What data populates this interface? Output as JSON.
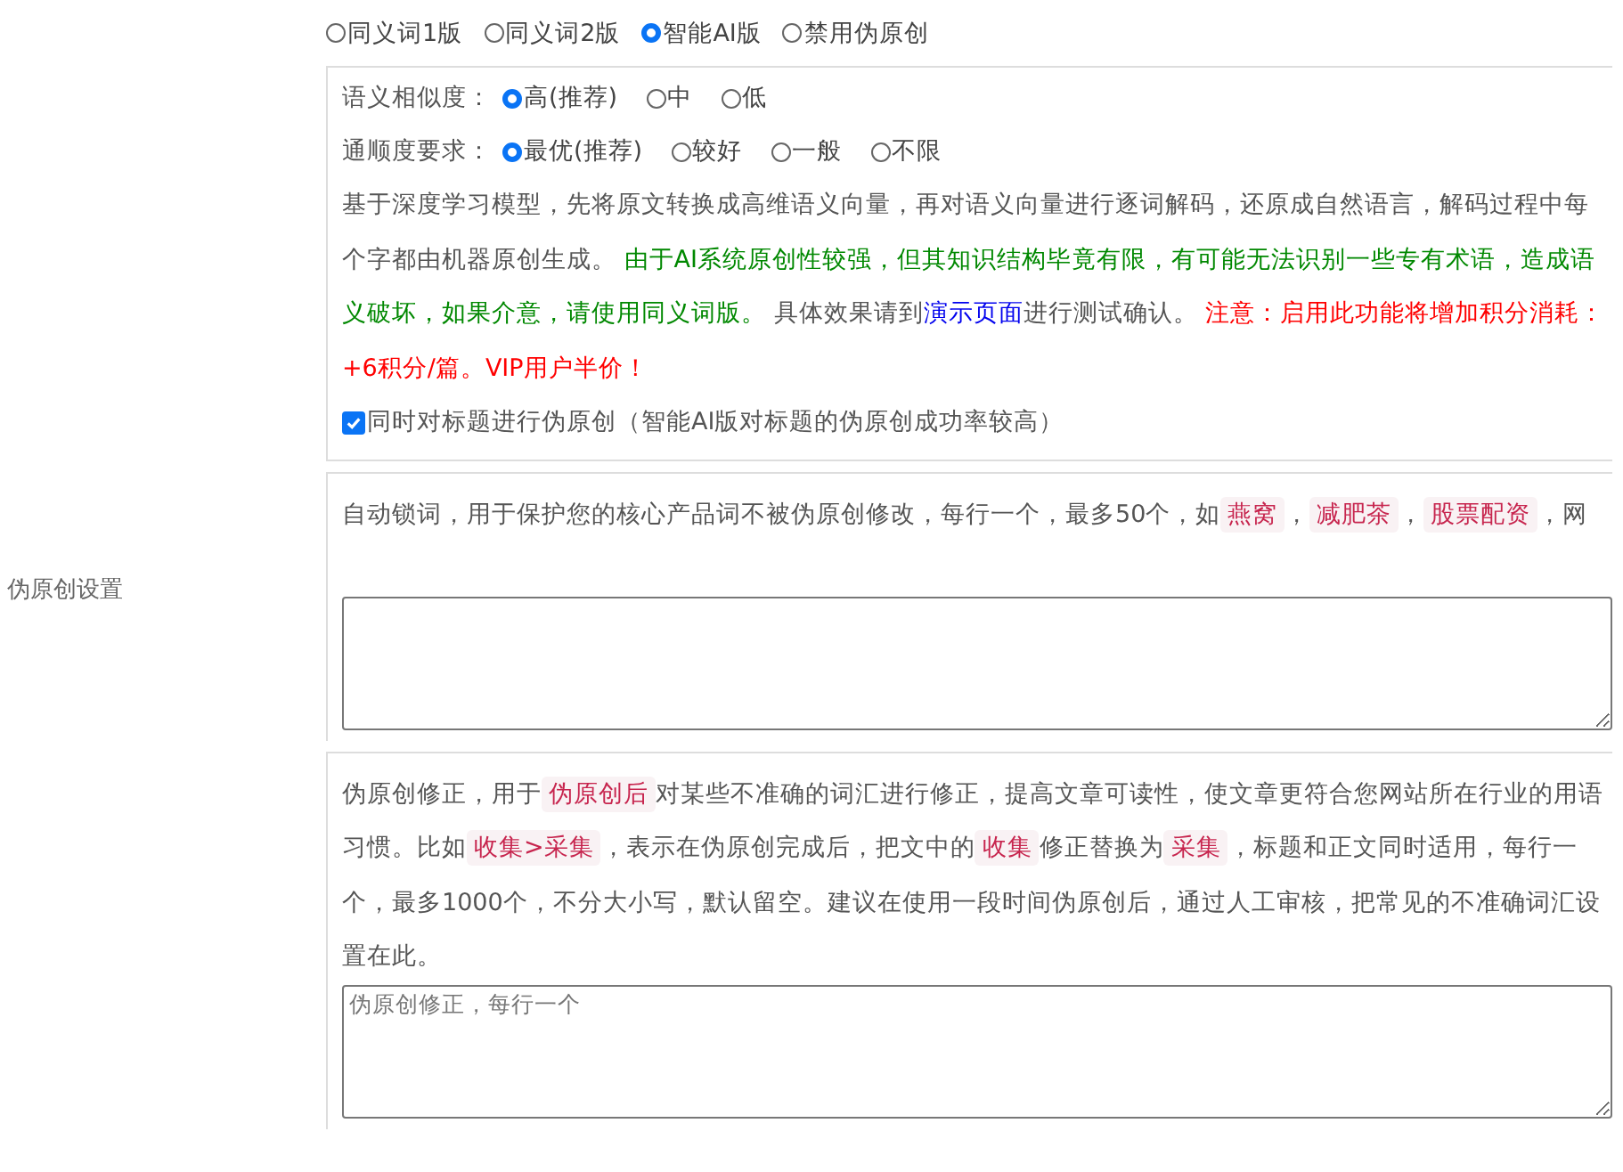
{
  "modes": [
    {
      "label": "同义词1版",
      "selected": false
    },
    {
      "label": "同义词2版",
      "selected": false
    },
    {
      "label": "智能AI版",
      "selected": true
    },
    {
      "label": "禁用伪原创",
      "selected": false
    }
  ],
  "ai_settings": {
    "options": [
      {
        "label": "语义相似度：",
        "choices": [
          {
            "label": "高(推荐)",
            "selected": true
          },
          {
            "label": "中",
            "selected": false
          },
          {
            "label": "低",
            "selected": false
          }
        ]
      },
      {
        "label": "通顺度要求：",
        "choices": [
          {
            "label": "最优(推荐)",
            "selected": true
          },
          {
            "label": "较好",
            "selected": false
          },
          {
            "label": "一般",
            "selected": false
          },
          {
            "label": "不限",
            "selected": false
          }
        ]
      }
    ],
    "description": [
      {
        "kind": "plain",
        "text": "基于深度学习模型，先将原文转换成高维语义向量，再对语义向量进行逐词解码，还原成自然语言，解码过程中每个字都由机器原创生成。 "
      },
      {
        "kind": "green",
        "text": "由于AI系统原创性较强，但其知识结构毕竟有限，有可能无法识别一些专有术语，造成语义破坏，如果介意，请使用同义词版。"
      },
      {
        "kind": "plain",
        "text": " 具体效果请到"
      },
      {
        "kind": "link",
        "text": "演示页面"
      },
      {
        "kind": "plain",
        "text": "进行测试确认。 "
      },
      {
        "kind": "red",
        "text": "注意：启用此功能将增加积分消耗：+6积分/篇。VIP用户半价！"
      }
    ],
    "title_option": {
      "label": "同时对标题进行伪原创（智能AI版对标题的伪原创成功率较高）",
      "checked": true
    }
  },
  "section_label": "伪原创设置",
  "lock_words": {
    "description": [
      {
        "kind": "plain",
        "text": "自动锁词，用于保护您的核心产品词不被伪原创修改，每行一个，最多50个，如"
      },
      {
        "kind": "tag",
        "text": "燕窝"
      },
      {
        "kind": "plain",
        "text": "，"
      },
      {
        "kind": "tag",
        "text": "减肥茶"
      },
      {
        "kind": "plain",
        "text": "，"
      },
      {
        "kind": "tag",
        "text": "股票配资"
      },
      {
        "kind": "plain",
        "text": "，网"
      }
    ]
  },
  "correction": {
    "description": [
      {
        "kind": "plain",
        "text": "伪原创修正，用于"
      },
      {
        "kind": "tag",
        "text": "伪原创后"
      },
      {
        "kind": "plain",
        "text": "对某些不准确的词汇进行修正，提高文章可读性，使文章更符合您网站所在行业的用语习惯。比如"
      },
      {
        "kind": "tag",
        "text": "收集>采集"
      },
      {
        "kind": "plain",
        "text": "，表示在伪原创完成后，把文中的"
      },
      {
        "kind": "tag",
        "text": "收集"
      },
      {
        "kind": "plain",
        "text": "修正替换为"
      },
      {
        "kind": "tag",
        "text": "采集"
      },
      {
        "kind": "plain",
        "text": "，标题和正文同时适用，每行一个，最多1000个，不分大小写，默认留空。建议在使用一段时间伪原创后，通过人工审核，把常见的不准确词汇设置在此。"
      }
    ],
    "placeholder": "伪原创修正，每行一个"
  }
}
